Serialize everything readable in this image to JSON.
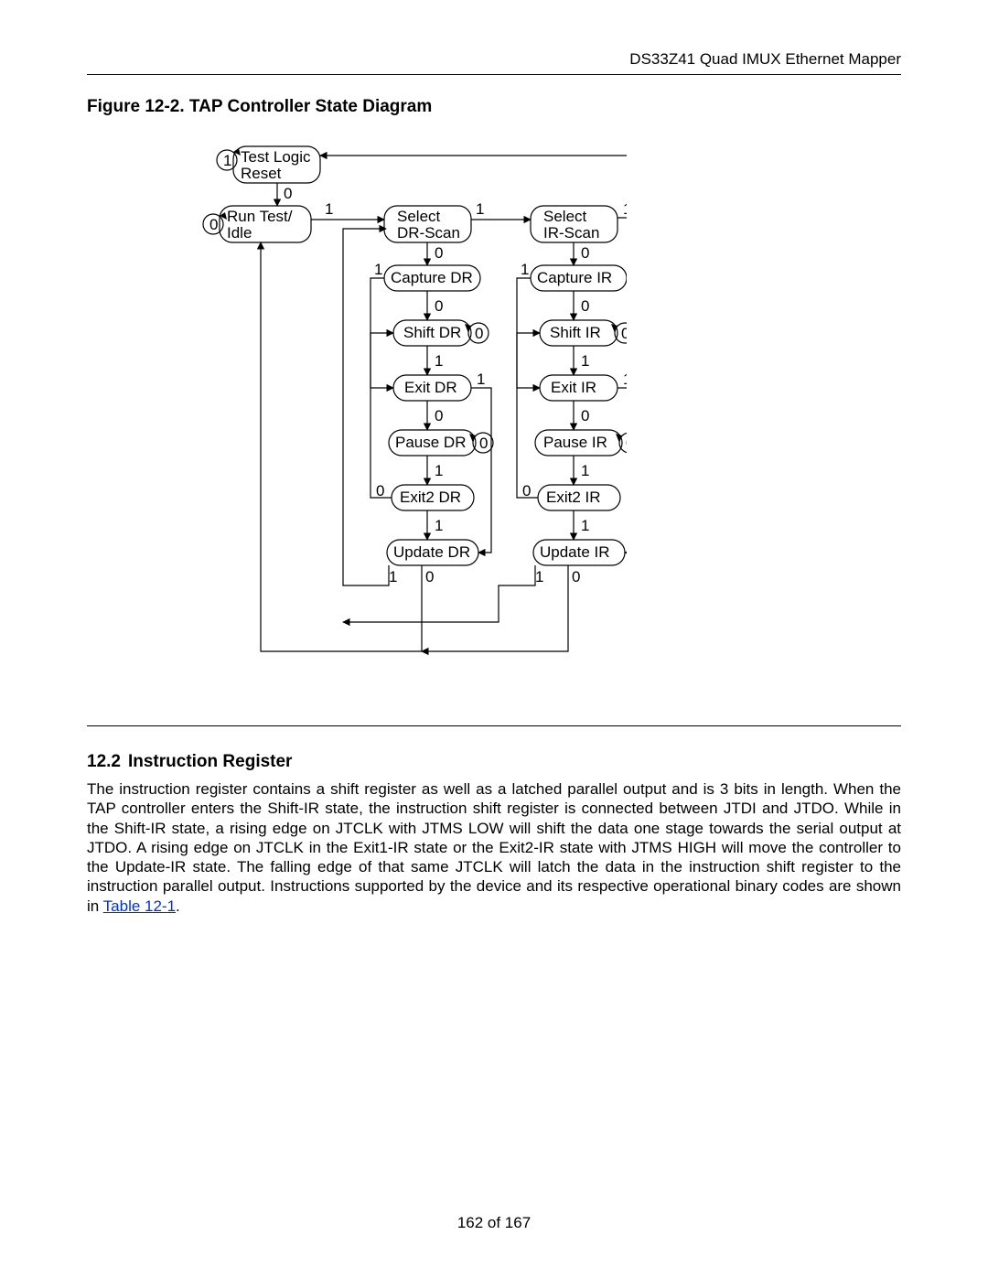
{
  "header": {
    "doc_title": "DS33Z41 Quad IMUX Ethernet Mapper"
  },
  "figure": {
    "caption": "Figure 12-2. TAP Controller State Diagram"
  },
  "section": {
    "number": "12.2",
    "title": "Instruction Register",
    "body_pre": "The instruction register contains a shift register as well as a latched parallel output and is 3 bits in length. When the TAP controller enters the Shift-IR state, the instruction shift register is connected between JTDI and JTDO. While in the Shift-IR state, a rising edge on JTCLK with JTMS LOW will shift the data one stage towards the serial output at JTDO. A rising edge on JTCLK in the Exit1-IR state or the Exit2-IR state with JTMS HIGH will move the controller to the Update-IR state. The falling edge of that same JTCLK will latch the data in the instruction shift register to the instruction parallel output. Instructions supported by the device and its respective operational binary codes are shown in ",
    "link_text": "Table 12-1",
    "body_post": "."
  },
  "footer": {
    "page_text": "162 of 167"
  },
  "state_diagram": {
    "states": {
      "test_logic_reset": "Test Logic\nReset",
      "run_test_idle": "Run Test/\nIdle",
      "select_dr_scan": "Select\nDR-Scan",
      "select_ir_scan": "Select\nIR-Scan",
      "capture_dr": "Capture DR",
      "capture_ir": "Capture IR",
      "shift_dr": "Shift DR",
      "shift_ir": "Shift IR",
      "exit_dr": "Exit DR",
      "exit_ir": "Exit IR",
      "pause_dr": "Pause DR",
      "pause_ir": "Pause IR",
      "exit2_dr": "Exit2 DR",
      "exit2_ir": "Exit2 IR",
      "update_dr": "Update DR",
      "update_ir": "Update IR"
    },
    "label_zero": "0",
    "label_one": "1"
  }
}
